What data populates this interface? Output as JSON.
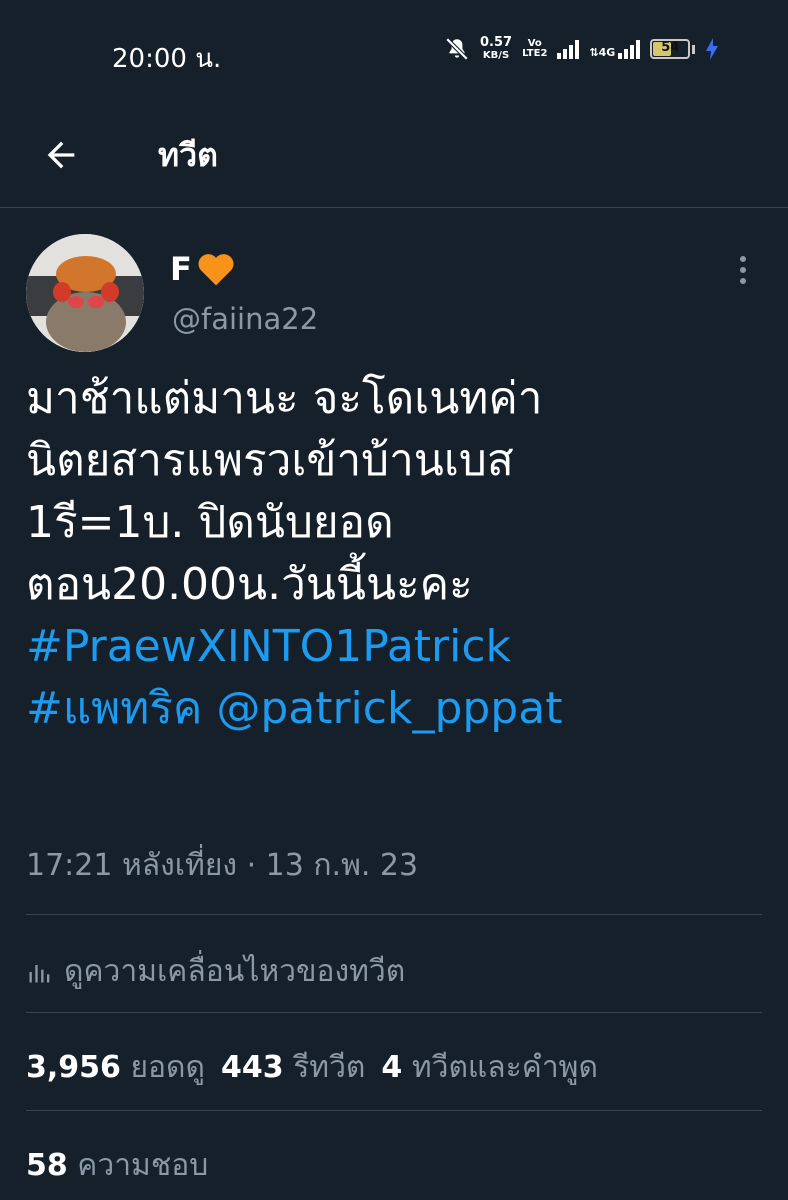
{
  "status_bar": {
    "time": "20:00 น.",
    "net_speed_value": "0.57",
    "net_speed_unit": "KB/S",
    "volte_top": "Vo",
    "volte_bottom": "LTE2",
    "network_type": "4G",
    "battery_percent": 54,
    "battery_label": "54",
    "icons": [
      "mute-icon",
      "signal-icon",
      "battery-icon",
      "charging-icon"
    ]
  },
  "header": {
    "title": "ทวีต",
    "back_icon": "arrow-left-icon"
  },
  "tweet": {
    "display_name": "F",
    "name_emoji": "orange-heart-icon",
    "handle": "@faiina22",
    "lines": [
      "มาช้าแต่มานะ จะโดเนทค่า",
      "นิตยสารแพรวเข้าบ้านเบส",
      "1รี=1บ. ปิดนับยอด",
      "ตอน20.00น.วันนี้นะคะ"
    ],
    "hashtag_1": "#PraewXINTO1Patrick",
    "hashtag_2": "#แพทริค",
    "mention": "@patrick_pppat",
    "timestamp": "17:21 หลังเที่ยง · 13 ก.พ. 23"
  },
  "activity": {
    "label": "ดูความเคลื่อนไหวของทวีต",
    "icon": "analytics-icon"
  },
  "stats": {
    "views_count": "3,956",
    "views_label": "ยอดดู",
    "retweets_count": "443",
    "retweets_label": "รีทวีต",
    "quotes_count": "4",
    "quotes_label": "ทวีตและคำพูด",
    "likes_count": "58",
    "likes_label": "ความชอบ"
  },
  "colors": {
    "background": "#15202b",
    "link": "#1d9bf0",
    "secondary_text": "#8b98a5",
    "divider": "#38444d"
  }
}
